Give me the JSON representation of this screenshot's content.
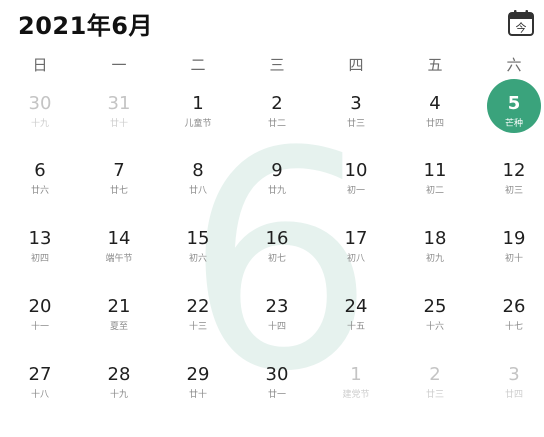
{
  "header": {
    "title": "2021年6月",
    "today_icon": "calendar-today-icon",
    "today_icon_label": "今"
  },
  "weekdays": [
    "日",
    "一",
    "二",
    "三",
    "四",
    "五",
    "六"
  ],
  "watermark": "6",
  "accent_color": "#3aa37c",
  "weeks": [
    [
      {
        "day": "30",
        "lunar": "十九",
        "other": true
      },
      {
        "day": "31",
        "lunar": "廿十",
        "other": true
      },
      {
        "day": "1",
        "lunar": "儿童节"
      },
      {
        "day": "2",
        "lunar": "廿二"
      },
      {
        "day": "3",
        "lunar": "廿三"
      },
      {
        "day": "4",
        "lunar": "廿四"
      },
      {
        "day": "5",
        "lunar": "芒种",
        "today": true
      }
    ],
    [
      {
        "day": "6",
        "lunar": "廿六"
      },
      {
        "day": "7",
        "lunar": "廿七"
      },
      {
        "day": "8",
        "lunar": "廿八"
      },
      {
        "day": "9",
        "lunar": "廿九"
      },
      {
        "day": "10",
        "lunar": "初一"
      },
      {
        "day": "11",
        "lunar": "初二"
      },
      {
        "day": "12",
        "lunar": "初三"
      }
    ],
    [
      {
        "day": "13",
        "lunar": "初四"
      },
      {
        "day": "14",
        "lunar": "端午节"
      },
      {
        "day": "15",
        "lunar": "初六"
      },
      {
        "day": "16",
        "lunar": "初七"
      },
      {
        "day": "17",
        "lunar": "初八"
      },
      {
        "day": "18",
        "lunar": "初九"
      },
      {
        "day": "19",
        "lunar": "初十"
      }
    ],
    [
      {
        "day": "20",
        "lunar": "十一"
      },
      {
        "day": "21",
        "lunar": "夏至"
      },
      {
        "day": "22",
        "lunar": "十三"
      },
      {
        "day": "23",
        "lunar": "十四"
      },
      {
        "day": "24",
        "lunar": "十五"
      },
      {
        "day": "25",
        "lunar": "十六"
      },
      {
        "day": "26",
        "lunar": "十七"
      }
    ],
    [
      {
        "day": "27",
        "lunar": "十八"
      },
      {
        "day": "28",
        "lunar": "十九"
      },
      {
        "day": "29",
        "lunar": "廿十"
      },
      {
        "day": "30",
        "lunar": "廿一"
      },
      {
        "day": "1",
        "lunar": "建党节",
        "other": true
      },
      {
        "day": "2",
        "lunar": "廿三",
        "other": true
      },
      {
        "day": "3",
        "lunar": "廿四",
        "other": true
      }
    ]
  ]
}
